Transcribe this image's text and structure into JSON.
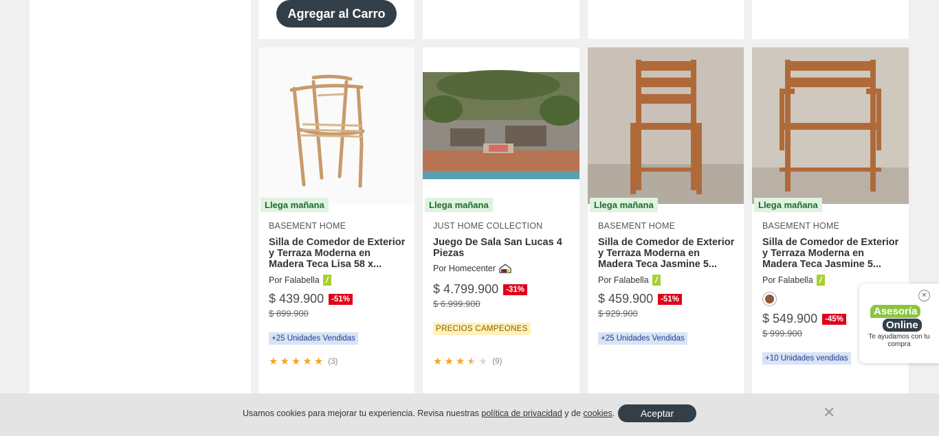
{
  "top_row": {
    "cart_button_label": "Agregar al Carro"
  },
  "products": [
    {
      "badge": "Llega mañana",
      "brand": "BASEMENT HOME",
      "title": "Silla de Comedor de Exterior y Terraza Moderna en Madera Teca Lisa 58 x...",
      "seller": "Por Falabella",
      "seller_icon": "falabella-icon",
      "price": "$ 439.900",
      "discount": "-51%",
      "old_price": "$ 899.900",
      "sold": "+25 Unidades Vendidas",
      "rating": 5,
      "reviews": "(3)"
    },
    {
      "badge": "Llega mañana",
      "brand": "JUST HOME COLLECTION",
      "title": "Juego De Sala San Lucas 4 Piezas",
      "seller": "Por Homecenter",
      "seller_icon": "homecenter-icon",
      "price": "$ 4.799.900",
      "discount": "-31%",
      "old_price": "$ 6.999.900",
      "campeones": "PRECIOS CAMPEONES",
      "rating": 3.5,
      "reviews": "(9)"
    },
    {
      "badge": "Llega mañana",
      "brand": "BASEMENT HOME",
      "title": "Silla de Comedor de Exterior y Terraza Moderna en Madera Teca Jasmine 5...",
      "seller": "Por Falabella",
      "seller_icon": "falabella-icon",
      "price": "$ 459.900",
      "discount": "-51%",
      "old_price": "$ 929.900",
      "sold": "+25 Unidades Vendidas"
    },
    {
      "badge": "Llega mañana",
      "brand": "BASEMENT HOME",
      "title": "Silla de Comedor de Exterior y Terraza Moderna en Madera Teca Jasmine 5...",
      "seller": "Por Falabella",
      "seller_icon": "falabella-icon",
      "price": "$ 549.900",
      "discount": "-45%",
      "old_price": "$ 999.900",
      "sold": "+10 Unidades vendidas",
      "swatch_color": "#8a5a3c"
    }
  ],
  "cookie": {
    "text_before": "Usamos cookies para mejorar tu experiencia. Revisa nuestras ",
    "privacy_link": "política de privacidad",
    "text_middle": " y de ",
    "cookies_link": "cookies",
    "text_after": ".",
    "accept_label": "Aceptar",
    "close_symbol": "✕"
  },
  "chat": {
    "line1": "Asesoría",
    "line2": "Online",
    "subtitle": "Te ayudamos con tu compra",
    "close_symbol": "✕"
  },
  "colors": {
    "accent_dark": "#333f48",
    "discount_red": "#e0001a",
    "star": "#f5a623",
    "falabella_green": "#a5d12c"
  }
}
